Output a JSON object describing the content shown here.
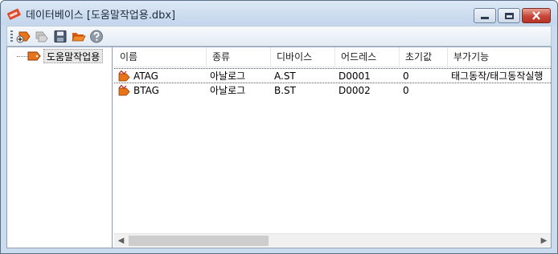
{
  "window": {
    "title": "데이터베이스 [도움말작업용.dbx]"
  },
  "toolbar": {
    "buttons": [
      {
        "name": "add-tag-button",
        "icon": "add-tag-icon"
      },
      {
        "name": "copy-tag-button",
        "icon": "copy-tag-icon",
        "disabled": true
      },
      {
        "name": "save-button",
        "icon": "floppy-disk-icon"
      },
      {
        "name": "open-folder-button",
        "icon": "folder-open-icon"
      },
      {
        "name": "help-button",
        "icon": "question-mark-icon"
      }
    ]
  },
  "tree": {
    "root_label": "도움말작업용"
  },
  "table": {
    "columns": [
      "이름",
      "종류",
      "디바이스",
      "어드레스",
      "초기값",
      "부가기능"
    ],
    "rows": [
      {
        "name": "ATAG",
        "type": "아날로그",
        "device": "A.ST",
        "address": "D0001",
        "initial": "0",
        "extra": "태그동작/태그동작실행"
      },
      {
        "name": "BTAG",
        "type": "아날로그",
        "device": "B.ST",
        "address": "D0002",
        "initial": "0",
        "extra": ""
      }
    ]
  },
  "colors": {
    "titlebar": "#c3d6ec",
    "close": "#c7463a",
    "icon_orange": "#e8731a"
  }
}
